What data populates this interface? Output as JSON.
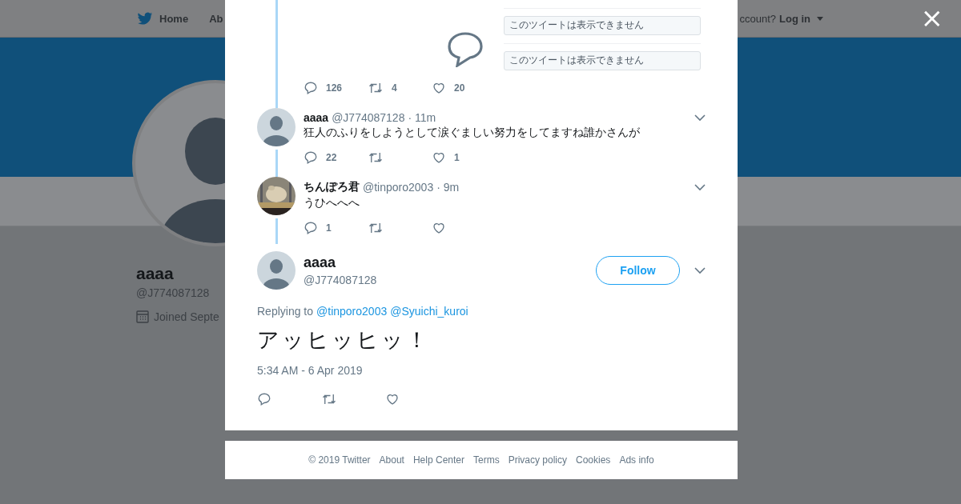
{
  "background_page": {
    "nav": {
      "items": [
        {
          "label": "Home",
          "kind": "logo"
        },
        {
          "label": "Ab",
          "kind": "plain"
        }
      ],
      "account_prompt": "ccount?",
      "login": "Log in"
    },
    "profile": {
      "name": "aaaa",
      "handle": "@J774087128",
      "joined": "Joined Septe"
    }
  },
  "close_label": "×",
  "thread": {
    "top_tweet": {
      "media_notices": [
        "このツイートは表示できません",
        "このツイートは表示できません"
      ],
      "actions": [
        {
          "kind": "reply",
          "count": "126"
        },
        {
          "kind": "retweet",
          "count": "4"
        },
        {
          "kind": "like",
          "count": "20"
        }
      ]
    },
    "replies": [
      {
        "name": "aaaa",
        "handle": "@J774087128",
        "time": "· 11m",
        "avatar": {
          "kind": "default"
        },
        "text": "狂人のふりをしようとして涙ぐましい努力をしてますね誰かさんが",
        "actions": [
          {
            "kind": "reply",
            "count": "22"
          },
          {
            "kind": "retweet"
          },
          {
            "kind": "like",
            "count": "1"
          }
        ]
      },
      {
        "name": "ちんぽろ君",
        "handle": "@tinporo2003",
        "time": "· 9m",
        "text": "うひへへへ",
        "actions": [
          {
            "kind": "reply",
            "count": "1"
          },
          {
            "kind": "retweet"
          },
          {
            "kind": "like"
          }
        ]
      }
    ],
    "main_tweet": {
      "name": "aaaa",
      "handle": "@J774087128",
      "follow": "Follow",
      "replying_to": "Replying to",
      "mentions": [
        "@tinporo2003",
        "@Syuichi_kuroi"
      ],
      "text": "アッヒッヒッ！",
      "timestamp": "5:34 AM - 6 Apr 2019",
      "actions": [
        {
          "kind": "reply"
        },
        {
          "kind": "retweet"
        },
        {
          "kind": "like"
        }
      ]
    }
  },
  "footer": {
    "copyright": "© 2019 Twitter",
    "links": [
      "About",
      "Help Center",
      "Terms",
      "Privacy policy",
      "Cookies",
      "Ads info"
    ]
  }
}
